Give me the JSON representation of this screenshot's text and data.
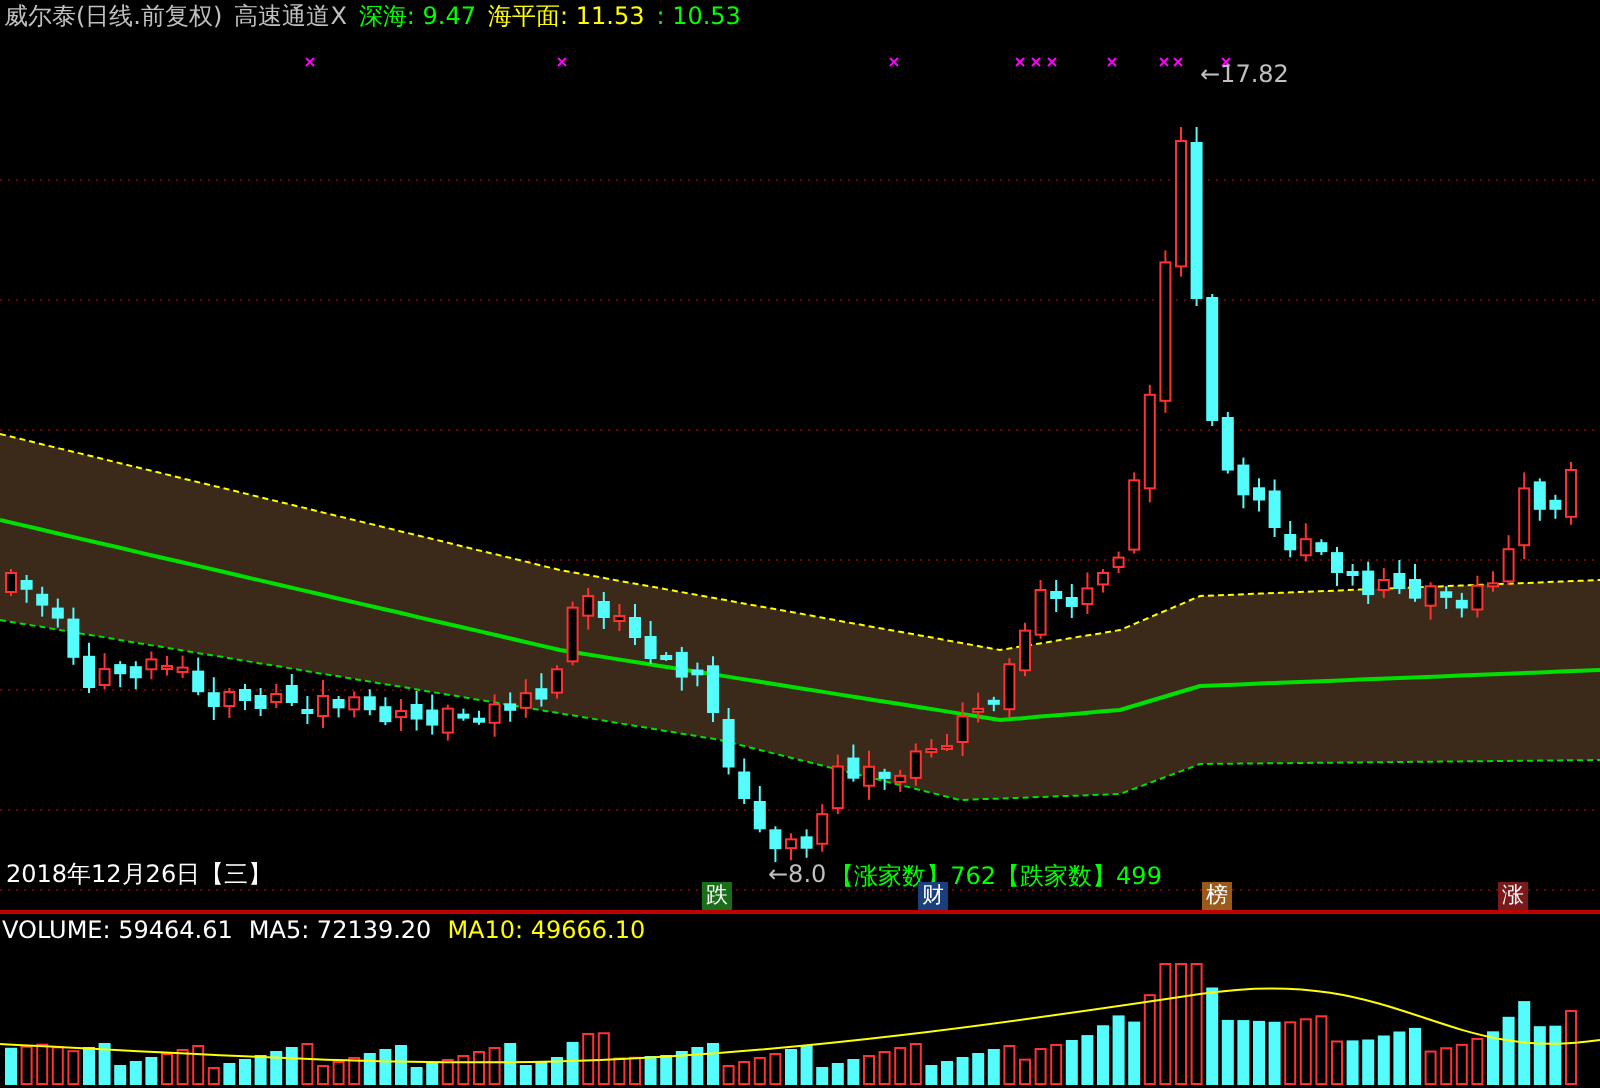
{
  "header": {
    "security": "威尔泰(日线.前复权)",
    "indicator": "高速通道X",
    "legend": [
      {
        "text": "深海: 9.47",
        "color": "#00ff00"
      },
      {
        "text": "海平面: 11.53",
        "color": "#ffff00"
      },
      {
        "text": ": 10.53",
        "color": "#00ff00"
      }
    ]
  },
  "price_chart": {
    "high_label": "←17.82",
    "low_label": "←8.0",
    "date": "2018年12月26日【三】",
    "breadth": "【涨家数】762【跌家数】499",
    "markers": [
      {
        "text": "跌",
        "color": "#1a6e1a"
      },
      {
        "text": "财",
        "color": "#1a3f7a"
      },
      {
        "text": "榜",
        "color": "#9a5a1a"
      },
      {
        "text": "涨",
        "color": "#7a1a1a"
      }
    ]
  },
  "volume": {
    "items": [
      {
        "text": "VOLUME: 59464.61",
        "color": "#ffffff"
      },
      {
        "text": "MA5: 72139.20",
        "color": "#ffffff"
      },
      {
        "text": "MA10: 49666.10",
        "color": "#ffff00"
      }
    ]
  }
}
